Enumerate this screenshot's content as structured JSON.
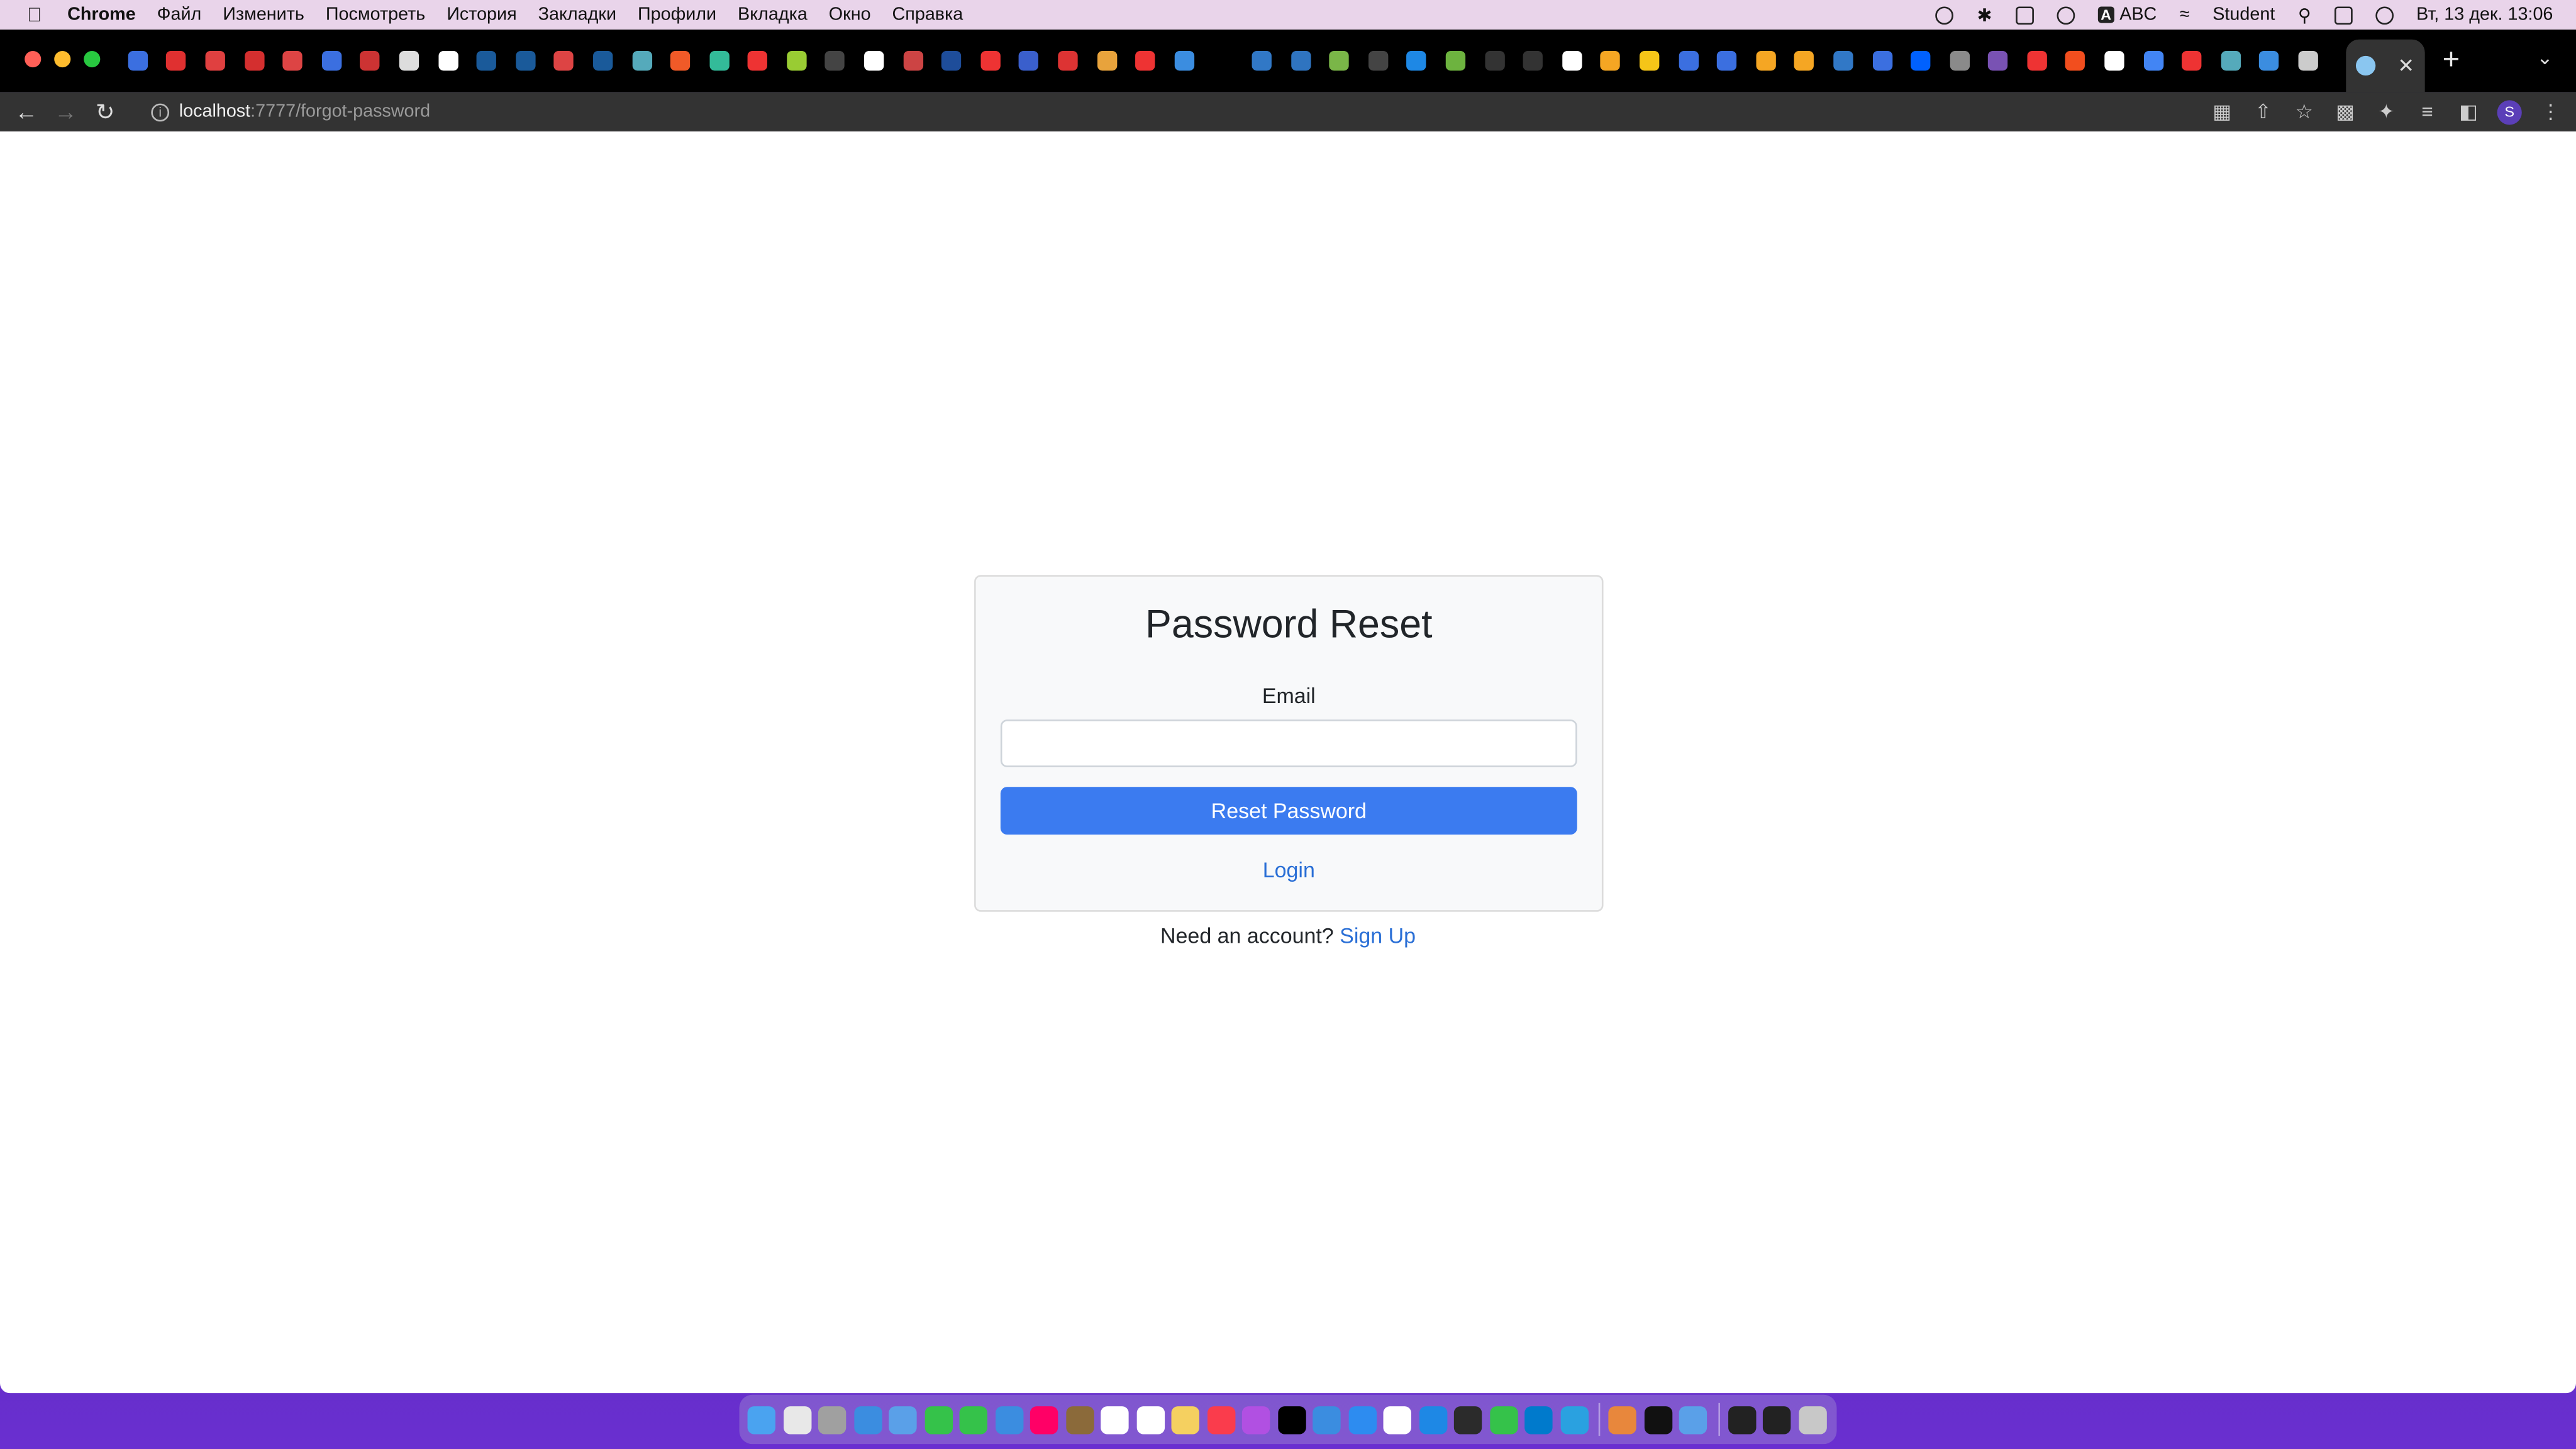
{
  "menubar": {
    "apple": "",
    "items": [
      "Chrome",
      "Файл",
      "Изменить",
      "Посмотреть",
      "История",
      "Закладки",
      "Профили",
      "Вкладка",
      "Окно",
      "Справка"
    ],
    "input_source": "ABC",
    "input_badge": "A",
    "user": "Student",
    "datetime": "Вт, 13 дек.  13:06"
  },
  "tabstrip": {
    "traffic_colors": [
      "#ff5f57",
      "#febc2e",
      "#28c840"
    ],
    "favicon_colors": [
      "#3b6fe0",
      "#e03030",
      "#e04040",
      "#d42f2f",
      "#d44",
      "#3b6fe0",
      "#c33",
      "#ddd",
      "#fff",
      "#1a5a9a",
      "#1a5a9a",
      "#d44",
      "#1a5a9a",
      "#5ab",
      "#f05a28",
      "#3b9",
      "#e33",
      "#9c3",
      "#444",
      "#fff",
      "#c44",
      "#1e4d9a",
      "#e33",
      "#3a5fcc",
      "#d33",
      "#e8a33c",
      "#e33",
      "#3b8de0",
      "#000",
      "#3178c6",
      "#2f74c0",
      "#7ab648",
      "#444",
      "#1e88e5",
      "#6db33f",
      "#333",
      "#333",
      "#fff",
      "#f5a623",
      "#f5c518",
      "#3b6fe0",
      "#3b6fe0",
      "#f5a623",
      "#f5a623",
      "#3178c6",
      "#3b6fe0",
      "#0061fe",
      "#8a8a8a",
      "#7952b3",
      "#e33",
      "#f24e1e",
      "#fff",
      "#4285f4",
      "#e33",
      "#5ab",
      "#3b8de0",
      "#ccc"
    ],
    "active_tab_close": "✕",
    "new_tab": "+",
    "tab_menu": "⌄"
  },
  "toolbar": {
    "back": "←",
    "forward": "→",
    "reload": "↻",
    "info": "i",
    "url_host": "localhost",
    "url_path": ":7777/forgot-password",
    "profile_initial": "S"
  },
  "form": {
    "title": "Password Reset",
    "email_label": "Email",
    "email_value": "",
    "email_placeholder": "",
    "submit_label": "Reset Password",
    "login_link": "Login",
    "accent_color": "#3b7bf0"
  },
  "footer": {
    "prompt": "Need an account?",
    "signup_link": "Sign Up"
  },
  "dock": {
    "icon_colors": [
      "#4aa3f0",
      "#e8e8e8",
      "#a0a0a0",
      "#3b8de0",
      "#5aa0e8",
      "#35c24a",
      "#35c24a",
      "#3b8de0",
      "#f06",
      "#8b6a3a",
      "#fff",
      "#fff",
      "#f5d060",
      "#fa3c4c",
      "#b150e2",
      "#000",
      "#3b8de0",
      "#2d8cf0",
      "#fff",
      "#1e88e5",
      "#2b2b2b",
      "#35c24a",
      "#007acc",
      "#2aa1e0"
    ],
    "extra_colors": [
      "#e8873c",
      "#111",
      "#5aa0e8"
    ],
    "minimized_colors": [
      "#222",
      "#222"
    ],
    "trash_color": "#c8c8c8"
  }
}
